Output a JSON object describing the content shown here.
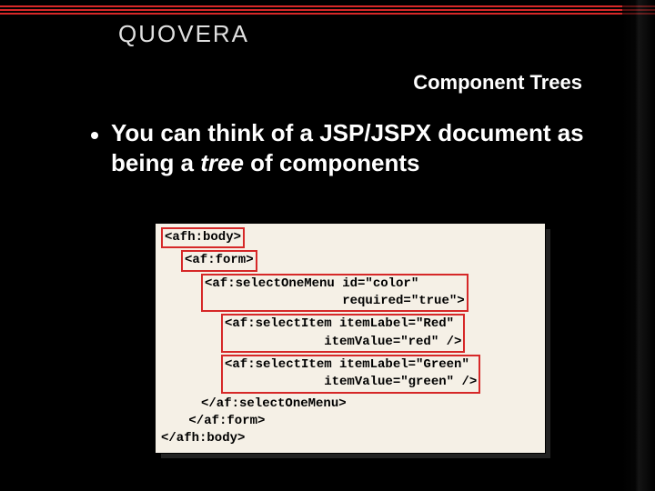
{
  "brand": "QUOVERA",
  "slide_title": "Component Trees",
  "bullet": {
    "pre": "You can think of a JSP/JSPX document as being a ",
    "em": "tree",
    "post": " of components"
  },
  "code": {
    "l1": "<afh:body>",
    "l2": " <af:form>",
    "l3a": "<af:selectOneMenu id=\"color\"",
    "l3b": "                  required=\"true\">",
    "l4a": "<af:selectItem itemLabel=\"Red\"",
    "l4b": "             itemValue=\"red\" />",
    "l5a": "<af:selectItem itemLabel=\"Green\"",
    "l5b": "             itemValue=\"green\" />",
    "l6": "</af:selectOneMenu>",
    "l7": " </af:form>",
    "l8": "</afh:body>"
  }
}
